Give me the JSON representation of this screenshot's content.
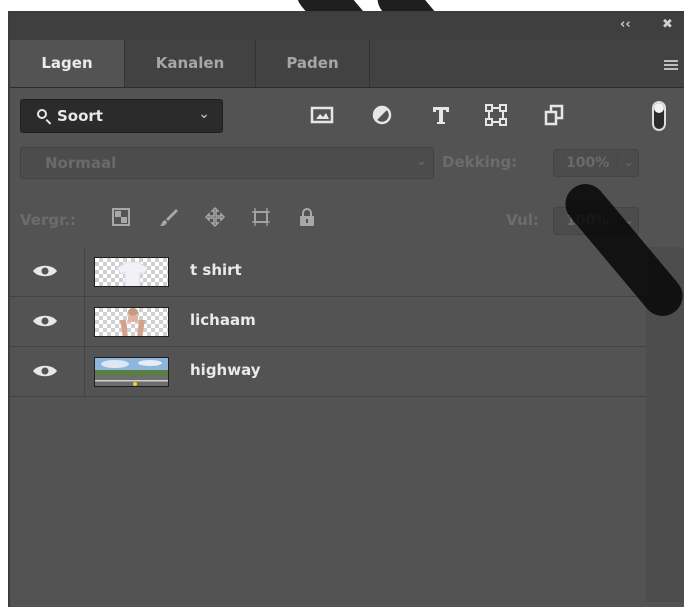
{
  "panel": {
    "title_icons": [
      "collapse-icon",
      "close-icon"
    ],
    "tabs": [
      {
        "label": "Lagen",
        "active": true
      },
      {
        "label": "Kanalen",
        "active": false
      },
      {
        "label": "Paden",
        "active": false
      }
    ]
  },
  "filter": {
    "kind_label": "Soort",
    "icons": [
      "pixel-filter-icon",
      "adjustment-filter-icon",
      "type-filter-icon",
      "shape-filter-icon",
      "smart-object-filter-icon"
    ]
  },
  "blend": {
    "mode": "Normaal",
    "opacity_label": "Dekking:",
    "opacity_value": "100%"
  },
  "lock": {
    "label": "Vergr.:",
    "icons": [
      "lock-transparent-pixels-icon",
      "lock-image-pixels-icon",
      "lock-position-icon",
      "artboard-lock-icon",
      "lock-all-icon"
    ],
    "fill_label": "Vul:",
    "fill_value": "100%"
  },
  "layers": [
    {
      "name": "t shirt",
      "visible": true,
      "thumb": "tshirt-thumbnail"
    },
    {
      "name": "lichaam",
      "visible": true,
      "thumb": "body-thumbnail"
    },
    {
      "name": "highway",
      "visible": true,
      "thumb": "highway-thumbnail"
    }
  ],
  "colors": {
    "panel_bg": "#535353",
    "tab_bar_bg": "#424242",
    "title_bar_bg": "#3f3f3f",
    "field_bg": "#2b2b2b",
    "text": "#eaeaea"
  }
}
